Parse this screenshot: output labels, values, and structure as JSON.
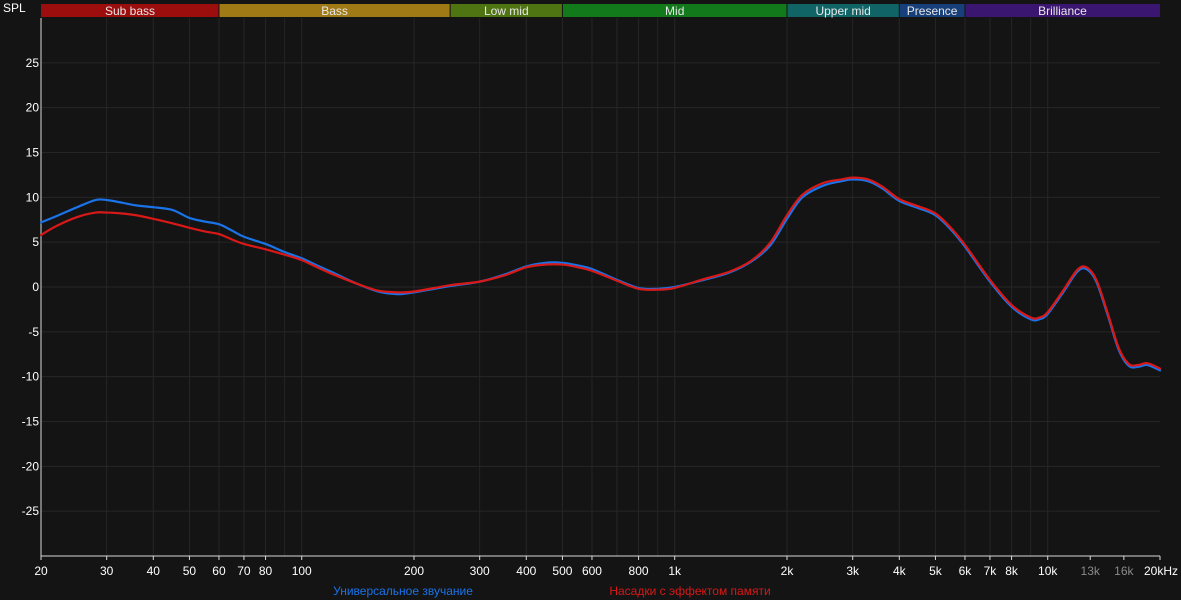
{
  "chart_data": {
    "type": "line",
    "ylabel": "SPL",
    "xscale": "log",
    "xlim": [
      20,
      20000
    ],
    "ylim": [
      -30,
      30
    ],
    "grid": true,
    "colors": {
      "background": "#141414",
      "grid": "#262626",
      "text": "#ffffff",
      "axis": "#d8d8d8"
    },
    "bands": [
      {
        "name": "Sub bass",
        "from": 20,
        "to": 60,
        "color": "#9c0d0d"
      },
      {
        "name": "Bass",
        "from": 60,
        "to": 250,
        "color": "#a07a15"
      },
      {
        "name": "Low mid",
        "from": 250,
        "to": 500,
        "color": "#4f7412"
      },
      {
        "name": "Mid",
        "from": 500,
        "to": 2000,
        "color": "#137a1c"
      },
      {
        "name": "Upper mid",
        "from": 2000,
        "to": 4000,
        "color": "#116466"
      },
      {
        "name": "Presence",
        "from": 4000,
        "to": 6000,
        "color": "#173f79"
      },
      {
        "name": "Brilliance",
        "from": 6000,
        "to": 20000,
        "color": "#3b1670"
      }
    ],
    "y_ticks": [
      25,
      20,
      15,
      10,
      5,
      0,
      -5,
      -10,
      -15,
      -20,
      -25
    ],
    "y_tick_labels": [
      "25",
      "20",
      "15",
      "10",
      "5",
      "0",
      "-5",
      "-10",
      "-15",
      "-20",
      "-25"
    ],
    "x_ticks": [
      {
        "value": 20,
        "label": "20",
        "dim": false
      },
      {
        "value": 30,
        "label": "30",
        "dim": false
      },
      {
        "value": 40,
        "label": "40",
        "dim": false
      },
      {
        "value": 50,
        "label": "50",
        "dim": false
      },
      {
        "value": 60,
        "label": "60",
        "dim": false
      },
      {
        "value": 70,
        "label": "70",
        "dim": false
      },
      {
        "value": 80,
        "label": "80",
        "dim": false
      },
      {
        "value": 100,
        "label": "100",
        "dim": false
      },
      {
        "value": 200,
        "label": "200",
        "dim": false
      },
      {
        "value": 300,
        "label": "300",
        "dim": false
      },
      {
        "value": 400,
        "label": "400",
        "dim": false
      },
      {
        "value": 500,
        "label": "500",
        "dim": false
      },
      {
        "value": 600,
        "label": "600",
        "dim": false
      },
      {
        "value": 800,
        "label": "800",
        "dim": false
      },
      {
        "value": 1000,
        "label": "1k",
        "dim": false
      },
      {
        "value": 2000,
        "label": "2k",
        "dim": false
      },
      {
        "value": 3000,
        "label": "3k",
        "dim": false
      },
      {
        "value": 4000,
        "label": "4k",
        "dim": false
      },
      {
        "value": 5000,
        "label": "5k",
        "dim": false
      },
      {
        "value": 6000,
        "label": "6k",
        "dim": false
      },
      {
        "value": 7000,
        "label": "7k",
        "dim": false
      },
      {
        "value": 8000,
        "label": "8k",
        "dim": false
      },
      {
        "value": 10000,
        "label": "10k",
        "dim": false
      },
      {
        "value": 13000,
        "label": "13k",
        "dim": true
      },
      {
        "value": 16000,
        "label": "16k",
        "dim": true
      },
      {
        "value": 20000,
        "label": "20kHz",
        "dim": false
      }
    ],
    "series": [
      {
        "name": "Универсальное звучание",
        "color": "#1a73e8",
        "x": [
          20,
          22,
          25,
          28,
          30,
          33,
          36,
          40,
          45,
          50,
          55,
          60,
          65,
          70,
          80,
          90,
          100,
          110,
          120,
          140,
          160,
          180,
          200,
          250,
          300,
          350,
          400,
          450,
          500,
          550,
          600,
          700,
          800,
          900,
          1000,
          1200,
          1400,
          1600,
          1800,
          2000,
          2200,
          2500,
          2800,
          3000,
          3300,
          3600,
          4000,
          4500,
          5000,
          5500,
          6000,
          7000,
          8000,
          9000,
          9500,
          10000,
          11000,
          12000,
          12700,
          13500,
          14500,
          15500,
          16500,
          17500,
          18500,
          20000
        ],
        "y": [
          7.2,
          7.9,
          8.9,
          9.7,
          9.7,
          9.4,
          9.1,
          8.9,
          8.6,
          7.7,
          7.3,
          7.0,
          6.3,
          5.6,
          4.8,
          3.9,
          3.2,
          2.4,
          1.7,
          0.4,
          -0.5,
          -0.8,
          -0.6,
          0.1,
          0.6,
          1.4,
          2.3,
          2.7,
          2.7,
          2.4,
          2.0,
          0.8,
          -0.1,
          -0.2,
          0.0,
          0.8,
          1.6,
          2.8,
          4.6,
          7.6,
          10.0,
          11.3,
          11.8,
          12.0,
          11.8,
          11.0,
          9.6,
          8.8,
          8.0,
          6.4,
          4.5,
          0.6,
          -2.2,
          -3.6,
          -3.6,
          -3.0,
          -0.6,
          1.7,
          2.0,
          0.6,
          -3.2,
          -7.0,
          -8.8,
          -8.9,
          -8.7,
          -9.3
        ]
      },
      {
        "name": "Насадки с эффектом памяти",
        "color": "#d91818",
        "x": [
          20,
          22,
          25,
          28,
          30,
          33,
          36,
          40,
          45,
          50,
          55,
          60,
          65,
          70,
          80,
          90,
          100,
          110,
          120,
          140,
          160,
          180,
          200,
          250,
          300,
          350,
          400,
          450,
          500,
          550,
          600,
          700,
          800,
          900,
          1000,
          1200,
          1400,
          1600,
          1800,
          2000,
          2200,
          2500,
          2800,
          3000,
          3300,
          3600,
          4000,
          4500,
          5000,
          5500,
          6000,
          7000,
          8000,
          9000,
          9500,
          10000,
          11000,
          12000,
          12700,
          13500,
          14500,
          15500,
          16500,
          17500,
          18500,
          20000
        ],
        "y": [
          5.8,
          6.8,
          7.8,
          8.3,
          8.3,
          8.2,
          8.0,
          7.6,
          7.1,
          6.6,
          6.2,
          5.9,
          5.3,
          4.8,
          4.2,
          3.6,
          3.0,
          2.2,
          1.5,
          0.4,
          -0.4,
          -0.6,
          -0.5,
          0.2,
          0.6,
          1.3,
          2.2,
          2.5,
          2.5,
          2.2,
          1.8,
          0.7,
          -0.2,
          -0.3,
          -0.1,
          0.9,
          1.7,
          2.9,
          4.9,
          8.0,
          10.3,
          11.6,
          12.0,
          12.2,
          12.0,
          11.2,
          9.8,
          9.0,
          8.2,
          6.6,
          4.7,
          0.8,
          -2.0,
          -3.4,
          -3.4,
          -2.8,
          -0.4,
          1.9,
          2.2,
          0.8,
          -3.0,
          -6.8,
          -8.6,
          -8.7,
          -8.5,
          -9.1
        ]
      }
    ]
  }
}
